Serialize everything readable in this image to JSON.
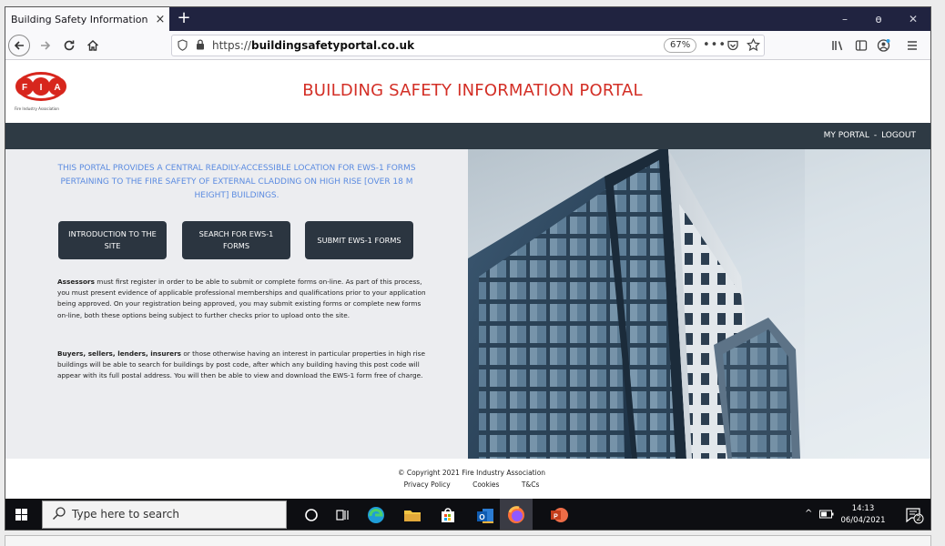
{
  "browser": {
    "tab_title": "Building Safety Information Portal",
    "tab_close": "×",
    "new_tab": "+",
    "url_prefix": "https://",
    "url_domain": "buildingsafetyportal.co.uk",
    "zoom": "67%",
    "page_actions": "•••",
    "window_minimize": "–",
    "window_restore": "ɵ",
    "window_close": "✕"
  },
  "site": {
    "logo_text": "Fire Industry Association",
    "title": "BUILDING SAFETY INFORMATION PORTAL",
    "nav": {
      "my_portal": "MY PORTAL",
      "separator": "-",
      "logout": "LOGOUT"
    },
    "intro": "THIS PORTAL PROVIDES A CENTRAL READILY-ACCESSIBLE LOCATION FOR EWS-1 FORMS PERTAINING TO THE FIRE SAFETY OF EXTERNAL CLADDING ON HIGH RISE [OVER 18 M HEIGHT] BUILDINGS.",
    "buttons": {
      "intro": "INTRODUCTION TO THE SITE",
      "search": "SEARCH FOR EWS-1 FORMS",
      "submit": "SUBMIT EWS-1 FORMS"
    },
    "para1_bold": "Assessors",
    "para1_text": " must first register in order to be able to submit or complete forms on-line. As part of this process, you must present evidence of applicable professional memberships and qualifications prior to your application being approved. On your registration being approved, you may submit existing forms or complete new forms on-line, both these options being subject to further checks prior to upload onto the site.",
    "para2_bold": "Buyers, sellers, lenders, insurers",
    "para2_text": " or those otherwise having an interest in particular properties in high rise buildings will be able to search for buildings by post code, after which any building having this post code will appear with its full postal address. You will then be able to view and download the EWS-1 form free of charge.",
    "footer": {
      "copyright": "© Copyright 2021 Fire Industry Association",
      "privacy": "Privacy Policy",
      "cookies": "Cookies",
      "tcs": "T&Cs"
    }
  },
  "taskbar": {
    "search_placeholder": "Type here to search",
    "time": "14:13",
    "date": "06/04/2021",
    "notification_count": "2"
  },
  "colors": {
    "accent_red": "#d32f26",
    "nav_dark": "#2e3a44",
    "intro_blue": "#5b8be0",
    "button_dark": "#2b3540"
  }
}
